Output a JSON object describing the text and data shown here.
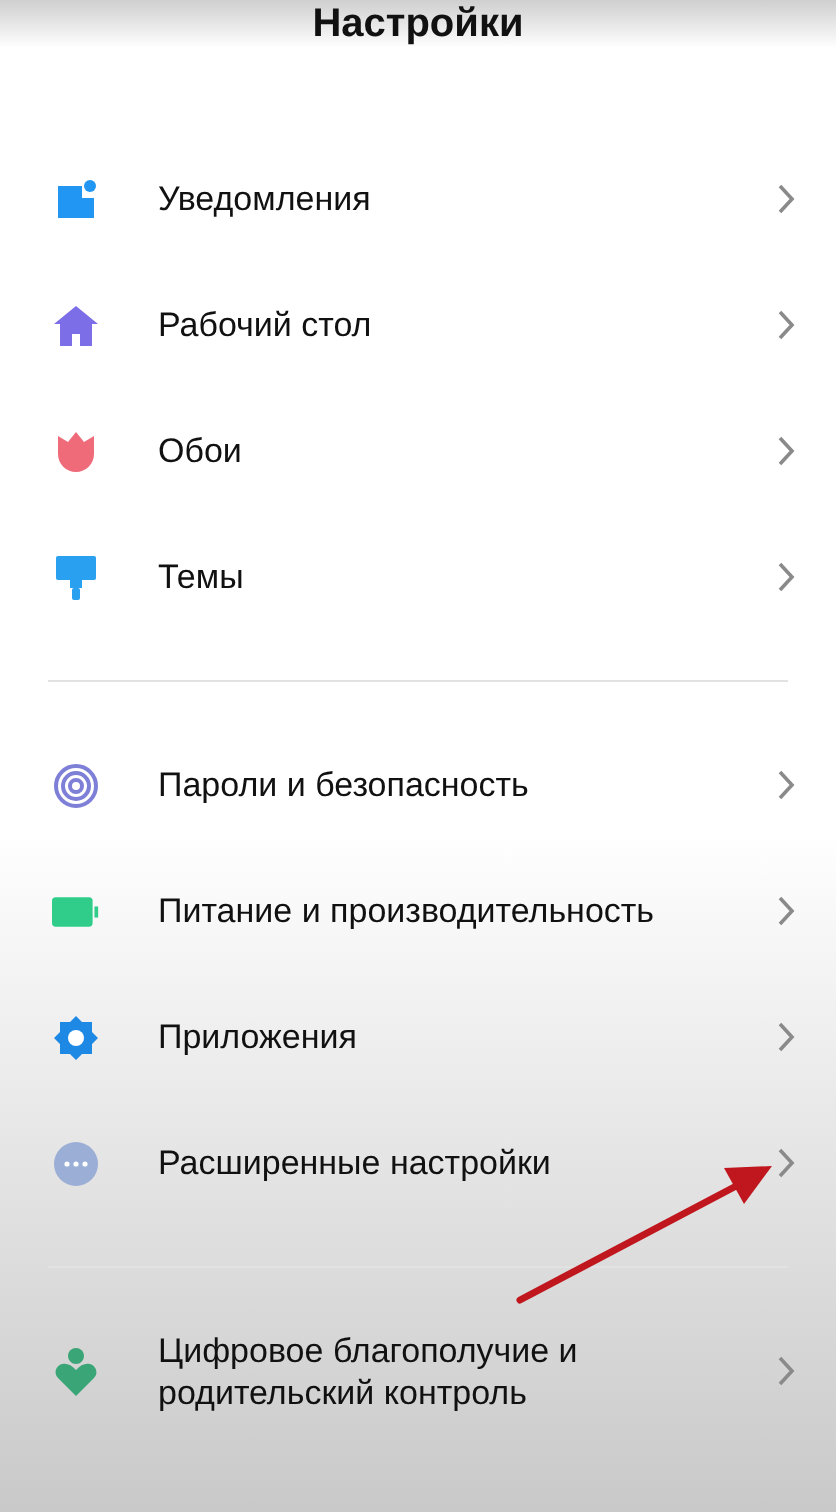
{
  "header": {
    "title": "Настройки"
  },
  "sections": [
    {
      "items": [
        {
          "kind": "notifications",
          "label": "Уведомления",
          "pointed": false
        },
        {
          "kind": "home",
          "label": "Рабочий стол",
          "pointed": false
        },
        {
          "kind": "tulip",
          "label": "Обои",
          "pointed": false
        },
        {
          "kind": "brush",
          "label": "Темы",
          "pointed": false
        }
      ]
    },
    {
      "items": [
        {
          "kind": "fingerprint",
          "label": "Пароли и безопасность",
          "pointed": false
        },
        {
          "kind": "battery",
          "label": "Питание и производительность",
          "pointed": false
        },
        {
          "kind": "gear",
          "label": "Приложения",
          "pointed": false
        },
        {
          "kind": "dots",
          "label": "Расширенные настройки",
          "pointed": true
        }
      ]
    },
    {
      "items": [
        {
          "kind": "wellbeing",
          "label": "Цифровое благополучие и родительский контроль",
          "pointed": false
        }
      ]
    }
  ]
}
